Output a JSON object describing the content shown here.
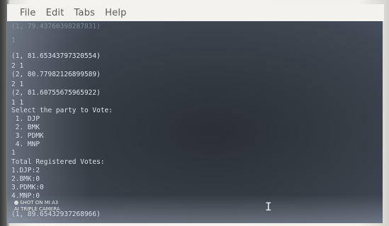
{
  "menu": {
    "file": "File",
    "edit": "Edit",
    "tabs": "Tabs",
    "help": "Help"
  },
  "terminal": {
    "lines": [
      "(1, 79.43760398287831)",
      "1",
      "(1, 81.65343797320554)",
      "2 1",
      "(2, 80.77982126899589)",
      "2 1",
      "(2, 81.60755675965922)",
      "1 1",
      "Select the party to Vote:",
      " 1. DJP",
      " 2. BMK",
      " 3. PDMK",
      " 4. MNP",
      "1",
      "Total Registered Votes:",
      "1.DJP:2",
      "2.BMK:0",
      "3.PDMK:0",
      "4.MNP:0",
      "(1, 89.65432937268966)"
    ]
  },
  "watermark": {
    "line1": "SHOT ON MI A3",
    "line2": "AI TRIPLE CAMERA"
  },
  "cursor_glyph": "I"
}
